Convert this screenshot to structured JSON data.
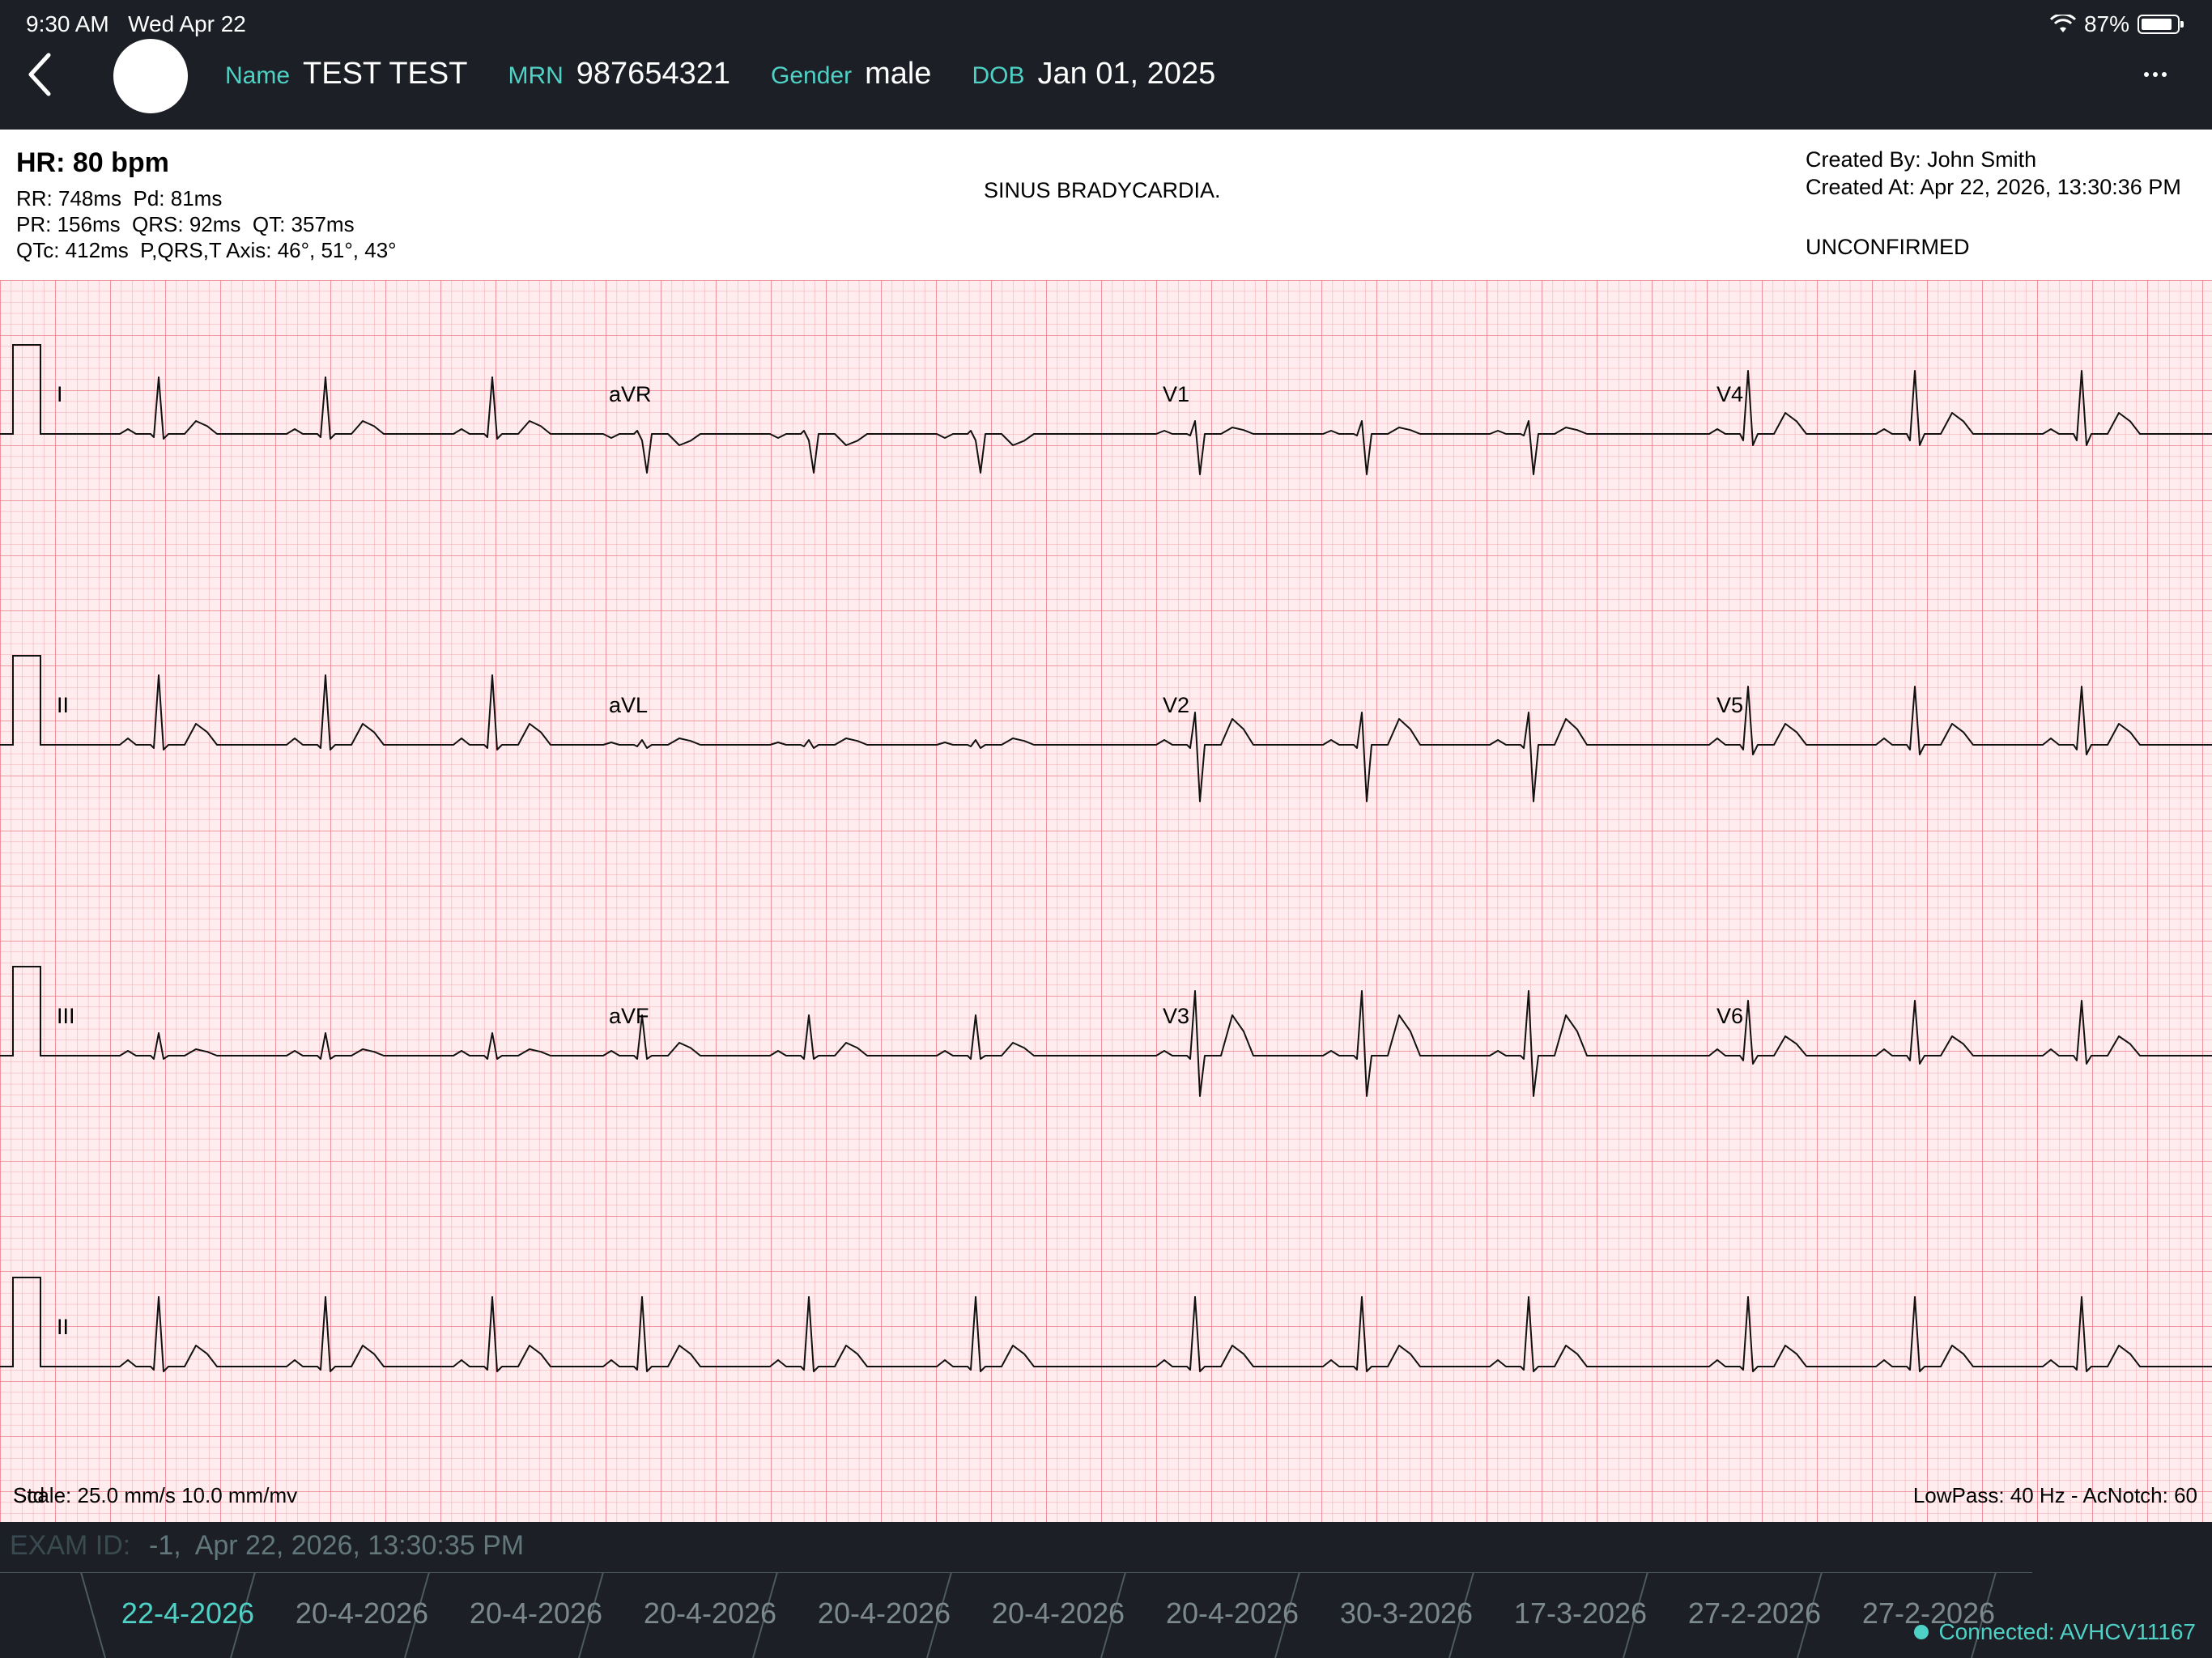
{
  "status_bar": {
    "time": "9:30 AM",
    "date": "Wed Apr 22",
    "battery": "87%",
    "battery_level": 0.87
  },
  "patient": {
    "name_label": "Name",
    "name": "TEST TEST",
    "mrn_label": "MRN",
    "mrn": "987654321",
    "gender_label": "Gender",
    "gender": "male",
    "dob_label": "DOB",
    "dob": "Jan 01, 2025"
  },
  "report": {
    "hr": "HR: 80 bpm",
    "line1": "RR: 748ms  Pd: 81ms",
    "line2": "PR: 156ms  QRS: 92ms  QT: 357ms",
    "line3": "QTc: 412ms  P,QRS,T Axis: 46°, 51°, 43°",
    "interpretation": "SINUS BRADYCARDIA.",
    "created_by": "Created By: John Smith",
    "created_at": "Created At: Apr 22, 2026, 13:30:36 PM",
    "status": "UNCONFIRMED"
  },
  "ecg": {
    "leads": [
      "I",
      "aVR",
      "V1",
      "V4",
      "II",
      "aVL",
      "V2",
      "V5",
      "III",
      "aVF",
      "V3",
      "V6",
      "II"
    ],
    "scale_overlap": "Std",
    "scale": "Scale: 25.0 mm/s 10.0 mm/mv",
    "filters": "LowPass: 40 Hz - AcNotch: 60",
    "grid_color": "#f08a94",
    "trace_color": "#111111"
  },
  "exam": {
    "label": "EXAM ID:",
    "value": "-1,  Apr 22, 2026, 13:30:35 PM"
  },
  "tabs": [
    "22-4-2026",
    "20-4-2026",
    "20-4-2026",
    "20-4-2026",
    "20-4-2026",
    "20-4-2026",
    "20-4-2026",
    "30-3-2026",
    "17-3-2026",
    "27-2-2026",
    "27-2-2026"
  ],
  "connection": "Connected: AVHCV11167",
  "colors": {
    "accent": "#4fd1c5",
    "dark_bg": "#1c1f26"
  }
}
